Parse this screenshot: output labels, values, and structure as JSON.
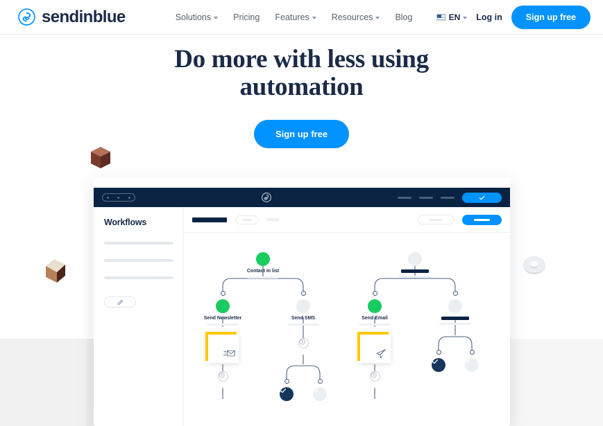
{
  "brand": {
    "name": "sendinblue",
    "logo_icon": "sendinblue-pinwheel-icon",
    "accent_blue": "#0092ff",
    "navy": "#1b2a47",
    "green": "#19cc5f",
    "yellow": "#ffc700"
  },
  "header": {
    "nav": [
      {
        "label": "Solutions",
        "has_caret": true
      },
      {
        "label": "Pricing",
        "has_caret": false
      },
      {
        "label": "Features",
        "has_caret": true
      },
      {
        "label": "Resources",
        "has_caret": true
      },
      {
        "label": "Blog",
        "has_caret": false
      }
    ],
    "language": "EN",
    "flag_icon": "us-flag-icon",
    "login_label": "Log in",
    "signup_label": "Sign up free"
  },
  "hero": {
    "title": "Do more with less using automation",
    "cta_label": "Sign up free"
  },
  "decor": [
    {
      "name": "copper-cube",
      "icon": "3d-cube-icon"
    },
    {
      "name": "copper-cube-left",
      "icon": "3d-cube-icon"
    },
    {
      "name": "silver-ring",
      "icon": "3d-torus-icon"
    }
  ],
  "mockup": {
    "window_logo_icon": "sendinblue-pinwheel-icon",
    "titlebar_button_icon": "check-icon",
    "sidebar": {
      "title": "Workflows",
      "placeholder_rows": 3,
      "edit_icon": "pencil-icon"
    },
    "toolbar": {
      "has_primary_button": true
    },
    "flow": {
      "nodes": [
        {
          "id": "contact-in-list",
          "label": "Contact in list",
          "status": "green",
          "icon": "check-icon"
        },
        {
          "id": "unnamed-top-right",
          "label": "",
          "status": "grey",
          "icon": "x-icon"
        },
        {
          "id": "send-newsletter",
          "label": "Send Newsletter",
          "status": "green",
          "icon": "check-icon"
        },
        {
          "id": "send-sms",
          "label": "Send SMS",
          "status": "grey",
          "icon": "x-icon"
        },
        {
          "id": "send-email",
          "label": "Send Email",
          "status": "green",
          "icon": "check-icon"
        },
        {
          "id": "unnamed-right",
          "label": "",
          "status": "grey",
          "icon": "x-icon"
        }
      ],
      "cards": [
        {
          "id": "newsletter-card",
          "icon": "envelope-icon"
        },
        {
          "id": "email-card",
          "icon": "paper-plane-icon"
        }
      ],
      "delays": [
        {
          "id": "delay-newsletter",
          "icon": "clock-icon"
        },
        {
          "id": "delay-sms",
          "icon": "clock-icon"
        },
        {
          "id": "delay-email",
          "icon": "clock-icon"
        }
      ],
      "outcomes": [
        {
          "id": "sms-yes",
          "status": "navy",
          "icon": "check-icon"
        },
        {
          "id": "sms-no",
          "status": "grey",
          "icon": "x-icon"
        },
        {
          "id": "right-yes",
          "status": "navy",
          "icon": "check-icon"
        },
        {
          "id": "right-no",
          "status": "grey",
          "icon": "x-icon"
        }
      ]
    }
  }
}
